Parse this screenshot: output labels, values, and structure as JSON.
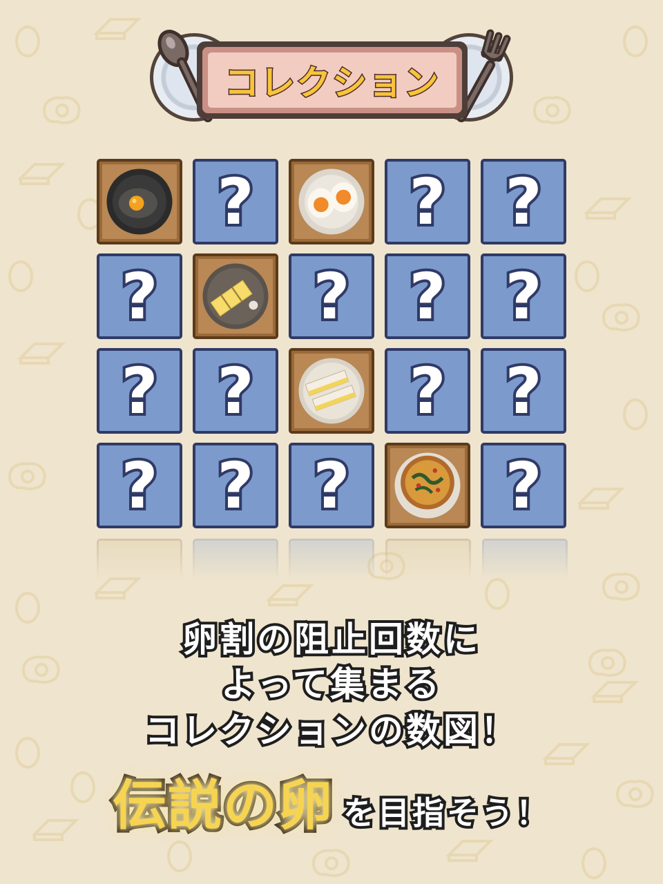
{
  "title": "コレクション",
  "grid": {
    "rows": 4,
    "columns": 5,
    "locked_symbol": "?",
    "tiles": [
      {
        "status": "found",
        "dish": "raw-egg-bowl"
      },
      {
        "status": "locked"
      },
      {
        "status": "found",
        "dish": "boiled-egg"
      },
      {
        "status": "locked"
      },
      {
        "status": "locked"
      },
      {
        "status": "locked"
      },
      {
        "status": "found",
        "dish": "tamagoyaki"
      },
      {
        "status": "locked"
      },
      {
        "status": "locked"
      },
      {
        "status": "locked"
      },
      {
        "status": "locked"
      },
      {
        "status": "locked"
      },
      {
        "status": "found",
        "dish": "egg-sandwich"
      },
      {
        "status": "locked"
      },
      {
        "status": "locked"
      },
      {
        "status": "locked"
      },
      {
        "status": "locked"
      },
      {
        "status": "locked"
      },
      {
        "status": "found",
        "dish": "quiche"
      },
      {
        "status": "locked"
      }
    ]
  },
  "caption": {
    "line1": "卵割の阻止回数に",
    "line2": "よって集まる",
    "line3": "コレクションの数図！",
    "highlight": "伝説の卵",
    "tail": "を目指そう！"
  },
  "colors": {
    "background": "#efe4cd",
    "locked_tile": "#7c9acb",
    "locked_border": "#2f3a66",
    "title_text": "#f7c43b",
    "highlight_text": "#f6d452"
  }
}
